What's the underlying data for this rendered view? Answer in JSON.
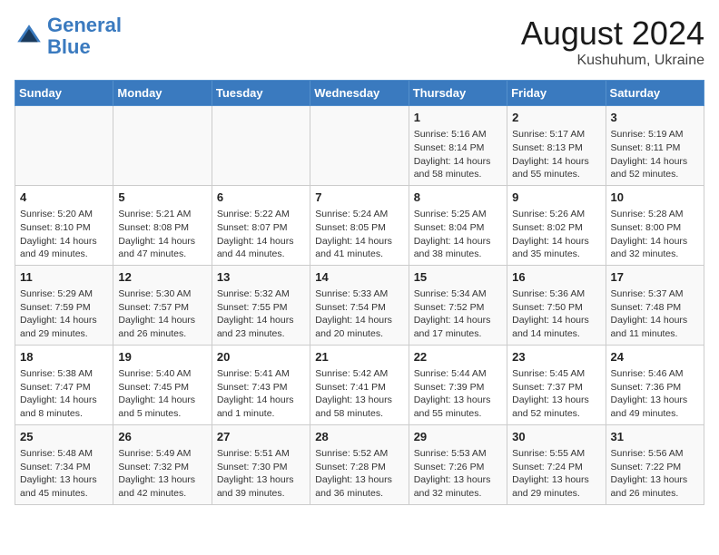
{
  "header": {
    "logo_line1": "General",
    "logo_line2": "Blue",
    "month_year": "August 2024",
    "location": "Kushuhum, Ukraine"
  },
  "weekdays": [
    "Sunday",
    "Monday",
    "Tuesday",
    "Wednesday",
    "Thursday",
    "Friday",
    "Saturday"
  ],
  "weeks": [
    [
      {
        "day": "",
        "info": ""
      },
      {
        "day": "",
        "info": ""
      },
      {
        "day": "",
        "info": ""
      },
      {
        "day": "",
        "info": ""
      },
      {
        "day": "1",
        "info": "Sunrise: 5:16 AM\nSunset: 8:14 PM\nDaylight: 14 hours\nand 58 minutes."
      },
      {
        "day": "2",
        "info": "Sunrise: 5:17 AM\nSunset: 8:13 PM\nDaylight: 14 hours\nand 55 minutes."
      },
      {
        "day": "3",
        "info": "Sunrise: 5:19 AM\nSunset: 8:11 PM\nDaylight: 14 hours\nand 52 minutes."
      }
    ],
    [
      {
        "day": "4",
        "info": "Sunrise: 5:20 AM\nSunset: 8:10 PM\nDaylight: 14 hours\nand 49 minutes."
      },
      {
        "day": "5",
        "info": "Sunrise: 5:21 AM\nSunset: 8:08 PM\nDaylight: 14 hours\nand 47 minutes."
      },
      {
        "day": "6",
        "info": "Sunrise: 5:22 AM\nSunset: 8:07 PM\nDaylight: 14 hours\nand 44 minutes."
      },
      {
        "day": "7",
        "info": "Sunrise: 5:24 AM\nSunset: 8:05 PM\nDaylight: 14 hours\nand 41 minutes."
      },
      {
        "day": "8",
        "info": "Sunrise: 5:25 AM\nSunset: 8:04 PM\nDaylight: 14 hours\nand 38 minutes."
      },
      {
        "day": "9",
        "info": "Sunrise: 5:26 AM\nSunset: 8:02 PM\nDaylight: 14 hours\nand 35 minutes."
      },
      {
        "day": "10",
        "info": "Sunrise: 5:28 AM\nSunset: 8:00 PM\nDaylight: 14 hours\nand 32 minutes."
      }
    ],
    [
      {
        "day": "11",
        "info": "Sunrise: 5:29 AM\nSunset: 7:59 PM\nDaylight: 14 hours\nand 29 minutes."
      },
      {
        "day": "12",
        "info": "Sunrise: 5:30 AM\nSunset: 7:57 PM\nDaylight: 14 hours\nand 26 minutes."
      },
      {
        "day": "13",
        "info": "Sunrise: 5:32 AM\nSunset: 7:55 PM\nDaylight: 14 hours\nand 23 minutes."
      },
      {
        "day": "14",
        "info": "Sunrise: 5:33 AM\nSunset: 7:54 PM\nDaylight: 14 hours\nand 20 minutes."
      },
      {
        "day": "15",
        "info": "Sunrise: 5:34 AM\nSunset: 7:52 PM\nDaylight: 14 hours\nand 17 minutes."
      },
      {
        "day": "16",
        "info": "Sunrise: 5:36 AM\nSunset: 7:50 PM\nDaylight: 14 hours\nand 14 minutes."
      },
      {
        "day": "17",
        "info": "Sunrise: 5:37 AM\nSunset: 7:48 PM\nDaylight: 14 hours\nand 11 minutes."
      }
    ],
    [
      {
        "day": "18",
        "info": "Sunrise: 5:38 AM\nSunset: 7:47 PM\nDaylight: 14 hours\nand 8 minutes."
      },
      {
        "day": "19",
        "info": "Sunrise: 5:40 AM\nSunset: 7:45 PM\nDaylight: 14 hours\nand 5 minutes."
      },
      {
        "day": "20",
        "info": "Sunrise: 5:41 AM\nSunset: 7:43 PM\nDaylight: 14 hours\nand 1 minute."
      },
      {
        "day": "21",
        "info": "Sunrise: 5:42 AM\nSunset: 7:41 PM\nDaylight: 13 hours\nand 58 minutes."
      },
      {
        "day": "22",
        "info": "Sunrise: 5:44 AM\nSunset: 7:39 PM\nDaylight: 13 hours\nand 55 minutes."
      },
      {
        "day": "23",
        "info": "Sunrise: 5:45 AM\nSunset: 7:37 PM\nDaylight: 13 hours\nand 52 minutes."
      },
      {
        "day": "24",
        "info": "Sunrise: 5:46 AM\nSunset: 7:36 PM\nDaylight: 13 hours\nand 49 minutes."
      }
    ],
    [
      {
        "day": "25",
        "info": "Sunrise: 5:48 AM\nSunset: 7:34 PM\nDaylight: 13 hours\nand 45 minutes."
      },
      {
        "day": "26",
        "info": "Sunrise: 5:49 AM\nSunset: 7:32 PM\nDaylight: 13 hours\nand 42 minutes."
      },
      {
        "day": "27",
        "info": "Sunrise: 5:51 AM\nSunset: 7:30 PM\nDaylight: 13 hours\nand 39 minutes."
      },
      {
        "day": "28",
        "info": "Sunrise: 5:52 AM\nSunset: 7:28 PM\nDaylight: 13 hours\nand 36 minutes."
      },
      {
        "day": "29",
        "info": "Sunrise: 5:53 AM\nSunset: 7:26 PM\nDaylight: 13 hours\nand 32 minutes."
      },
      {
        "day": "30",
        "info": "Sunrise: 5:55 AM\nSunset: 7:24 PM\nDaylight: 13 hours\nand 29 minutes."
      },
      {
        "day": "31",
        "info": "Sunrise: 5:56 AM\nSunset: 7:22 PM\nDaylight: 13 hours\nand 26 minutes."
      }
    ]
  ]
}
